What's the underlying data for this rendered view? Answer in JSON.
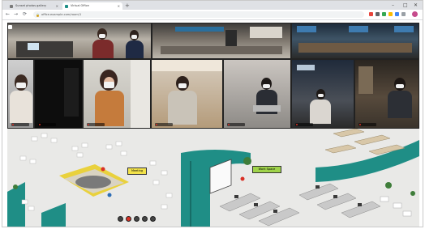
{
  "browser": {
    "tabs": [
      {
        "label": "Sunset photos gallery",
        "active": false
      },
      {
        "label": "Virtual Office",
        "active": true
      }
    ],
    "new_tab_label": "+",
    "window_controls": [
      "–",
      "□",
      "✕"
    ],
    "nav": {
      "back": "←",
      "forward": "→",
      "reload": "⟳"
    },
    "url": "office.example.com/room/1",
    "extension_colors": [
      "#e8453c",
      "#5f6368",
      "#34a853",
      "#fbbc04",
      "#4285f4",
      "#ea4335",
      "#9aa0a6"
    ]
  },
  "conference": {
    "tiles_top": [
      "participant-1",
      "participant-2",
      "participant-3"
    ],
    "tiles_bottom": [
      "participant-4",
      "participant-5",
      "participant-6",
      "participant-7",
      "participant-8"
    ]
  },
  "office_map": {
    "meeting_sign": "Meeting",
    "work_sign": "Work Space",
    "colors": {
      "floor": "#e9e9e7",
      "teal_wall": "#1f8e86",
      "yellow_sofa": "#e9d13d"
    }
  }
}
